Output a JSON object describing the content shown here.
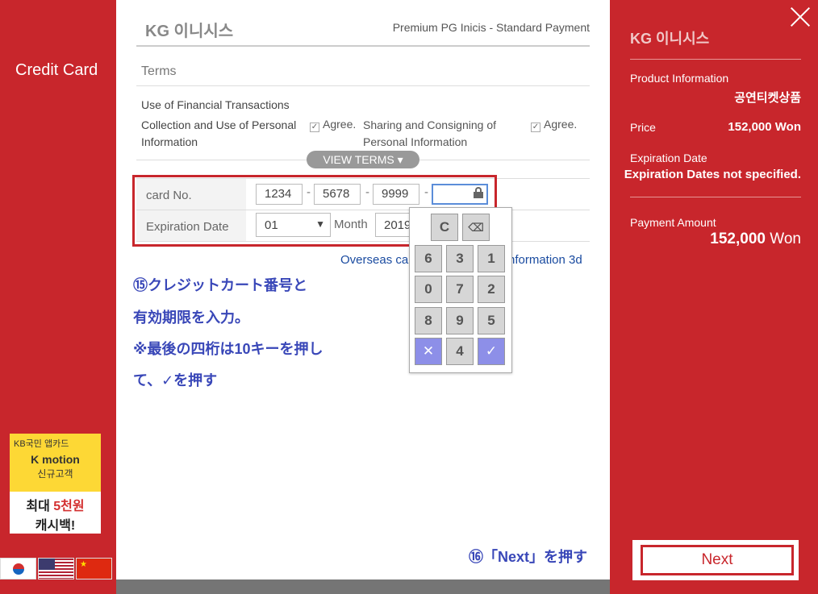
{
  "left": {
    "title": "Credit Card",
    "banner": {
      "line1": "KB국민 앱카드",
      "line2": "K motion",
      "line3": "신규고객",
      "line4_a": "최대 ",
      "line4_b": "5천원",
      "line5": "캐시백!"
    },
    "flags": [
      "korea-flag",
      "usa-flag",
      "china-flag"
    ]
  },
  "header": {
    "logo": "KG 이니시스",
    "subtitle": "Premium PG Inicis - Standard Payment"
  },
  "terms": {
    "title": "Terms",
    "financial": "Use of Financial Transactions",
    "collection": "Collection and Use of Personal Information",
    "agree1": "Agree.",
    "sharing": "Sharing and Consigning of Personal Information",
    "agree2": "Agree.",
    "view_terms": "VIEW TERMS ▾"
  },
  "form": {
    "card_label": "card No.",
    "card_parts": [
      "1234",
      "5678",
      "9999",
      ""
    ],
    "exp_label": "Expiration Date",
    "month_value": "01",
    "month_label": "Month",
    "year_value": "2019",
    "overseas_a": "Overseas car",
    "overseas_b": "nformation 3d"
  },
  "keypad": {
    "clear": "C",
    "backspace": "⌫",
    "keys": [
      "6",
      "3",
      "1",
      "0",
      "7",
      "2",
      "8",
      "9",
      "5",
      "✕",
      "4",
      "✓"
    ]
  },
  "notes": {
    "n15_1": "⑮クレジットカート番号と",
    "n15_2": "有効期限を入力。",
    "n15_3": "※最後の四桁は10キーを押し",
    "n15_4": "て、✓を押す",
    "n16": "⑯「Next」を押す"
  },
  "summary": {
    "logo": "KG 이니시스",
    "product_label": "Product Information",
    "product_value": "공연티켓상품",
    "price_label": "Price",
    "price_value": "152,000 Won",
    "exp_label": "Expiration Date",
    "exp_value": "Expiration Dates not specified.",
    "amount_label": "Payment Amount",
    "amount_number": "152,000",
    "amount_unit": "Won"
  },
  "next_button": "Next",
  "colors": {
    "brand_red": "#c8262c",
    "note_blue": "#3947b8",
    "keypad_blue": "#8d8fe8"
  }
}
